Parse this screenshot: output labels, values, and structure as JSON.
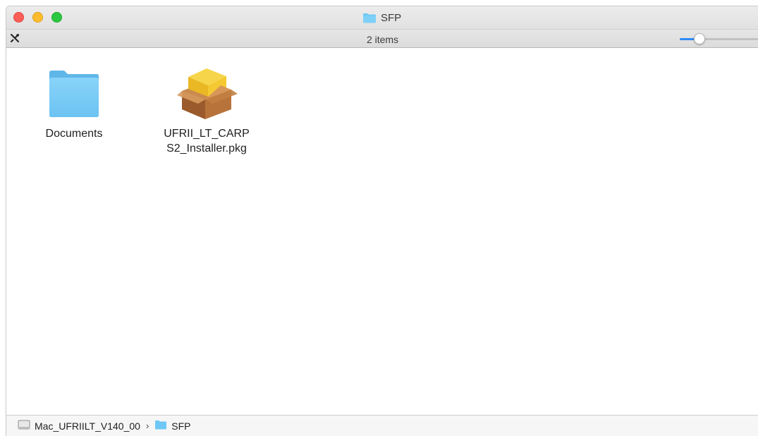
{
  "window": {
    "title": "SFP",
    "title_icon": "folder-icon"
  },
  "toolbar": {
    "left_icon": "tools-icon",
    "status_text": "2 items",
    "icon_size_slider": {
      "value": 0.25
    }
  },
  "files": [
    {
      "name": "Documents",
      "kind": "folder-icon"
    },
    {
      "name": "UFRII_LT_CARPS2_Installer.pkg",
      "kind": "package-icon"
    }
  ],
  "pathbar": {
    "segments": [
      {
        "label": "Mac_UFRIILT_V140_00",
        "icon": "drive-icon"
      },
      {
        "label": "SFP",
        "icon": "folder-icon"
      }
    ],
    "separator": "›"
  },
  "colors": {
    "close": "#fc5f57",
    "minimize": "#fdbc2e",
    "zoom": "#2ac840",
    "folder": "#6fc7f5",
    "accent": "#2f8bf7"
  }
}
